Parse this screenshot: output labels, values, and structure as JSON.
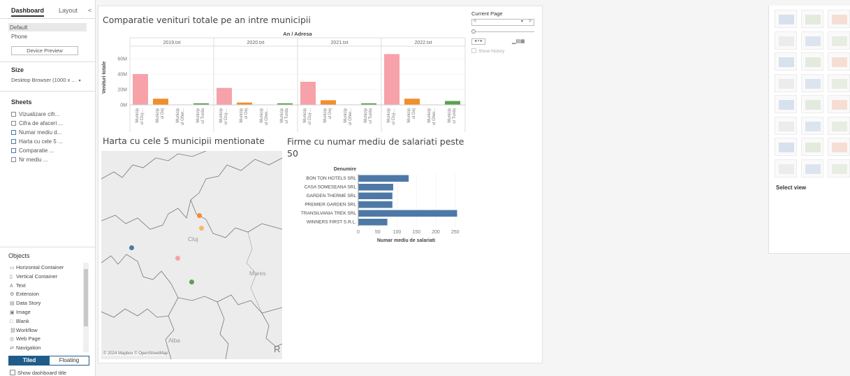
{
  "left_panel": {
    "tabs": [
      "Dashboard",
      "Layout"
    ],
    "collapse_glyph": "<",
    "devices": [
      "Default",
      "Phone"
    ],
    "device_preview_label": "Device Preview",
    "size_title": "Size",
    "size_value": "Desktop Browser (1000 x ...",
    "sheets_title": "Sheets",
    "sheets": [
      "Vizualizare cifr...",
      "Cifra de afaceri ...",
      "Numar mediu d...",
      "Harta cu cele 5 ...",
      "Comparatie ...",
      "Nr mediu ..."
    ],
    "objects_title": "Objects",
    "objects": [
      {
        "icon": "horizontal-container-icon",
        "label": "Horizontal Container"
      },
      {
        "icon": "vertical-container-icon",
        "label": "Vertical Container"
      },
      {
        "icon": "text-icon",
        "label": "Text"
      },
      {
        "icon": "extension-icon",
        "label": "Extension"
      },
      {
        "icon": "data-story-icon",
        "label": "Data Story"
      },
      {
        "icon": "image-icon",
        "label": "Image"
      },
      {
        "icon": "blank-icon",
        "label": "Blank"
      },
      {
        "icon": "workflow-icon",
        "label": "Workflow"
      },
      {
        "icon": "web-page-icon",
        "label": "Web Page"
      },
      {
        "icon": "navigation-icon",
        "label": "Navigation"
      }
    ],
    "tiled_label": "Tiled",
    "floating_label": "Floating",
    "show_title_label": "Show dashboard title"
  },
  "current_page": {
    "title": "Current Page",
    "show_history_label": "Show history"
  },
  "right_panel": {
    "select_view_label": "Select view"
  },
  "chart_data": [
    {
      "type": "bar",
      "title": "Comparatie venituri totale pe an intre municipii",
      "header": "An / Adresa",
      "ylabel": "Venituri totale",
      "yticks": [
        "0M",
        "20M",
        "40M",
        "60M"
      ],
      "ylim": [
        0,
        70
      ],
      "panels": [
        "2019.txt",
        "2020.txt",
        "2021.txt",
        "2022.txt"
      ],
      "categories": [
        "Municipiul Cluj-...",
        "Municipiul Dej",
        "Municipiul Gher...",
        "Municipiul Turda"
      ],
      "category_short": [
        "Municip\nul Cluj-...",
        "Municip\nul Dej",
        "Municip\nul Gher...",
        "Municip\nul Turda"
      ],
      "colors": [
        "#f7a1a8",
        "#f28e2b",
        "#f8b66e",
        "#59a14f"
      ],
      "values": [
        [
          40,
          8,
          0.5,
          2
        ],
        [
          22,
          3,
          0.5,
          2
        ],
        [
          30,
          6,
          0.5,
          2
        ],
        [
          66,
          8,
          0.5,
          5
        ]
      ]
    },
    {
      "type": "bar",
      "orientation": "horizontal",
      "title": "Firme cu numar mediu de salariati peste 50",
      "category_header": "Denumire",
      "categories": [
        "BON TON HOTELS SRL",
        "CASA SOMESEANA SRL",
        "GARDEN THERME SRL",
        "PREMIER GARDEN SRL",
        "TRANSILVANIA TREK SRL",
        "WINNERS FIRST S.R.L."
      ],
      "values": [
        130,
        90,
        88,
        88,
        255,
        75
      ],
      "xlabel": "Numar mediu de salariati",
      "xticks": [
        0,
        50,
        100,
        150,
        200,
        250
      ],
      "xlim": [
        0,
        265
      ],
      "color": "#4e79a7"
    }
  ],
  "map": {
    "title": "Harta cu cele 5 municipii mentionate",
    "labels": [
      "Cluj",
      "Mures",
      "Alba"
    ],
    "attribution": "© 2024 Mapbox © OpenStreetMap",
    "points": [
      {
        "color": "#f28e2b"
      },
      {
        "color": "#f8b66e"
      },
      {
        "color": "#4e79a7"
      },
      {
        "color": "#f7a1a8"
      },
      {
        "color": "#59a14f"
      }
    ]
  }
}
